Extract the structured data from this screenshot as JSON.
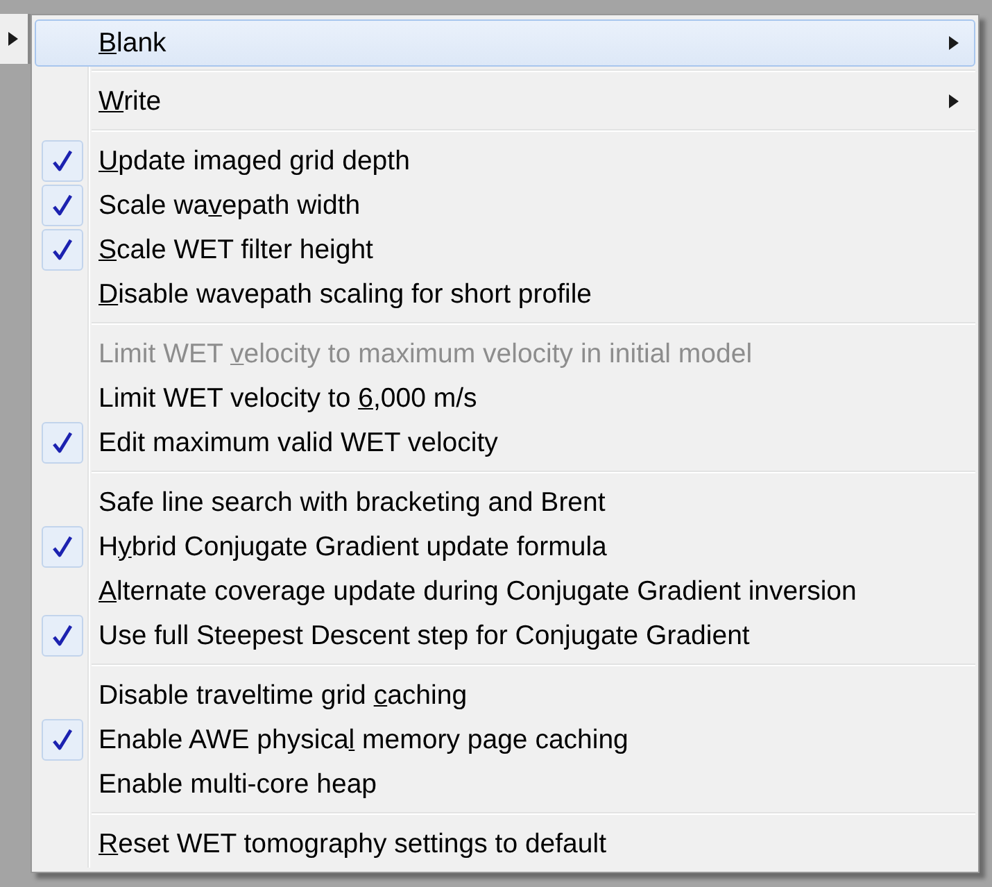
{
  "parent_menu": {
    "items": [
      {
        "submenu": true
      }
    ]
  },
  "menu": {
    "groups": [
      {
        "items": [
          {
            "access_key": "B",
            "text_after": "lank",
            "checked": false,
            "disabled": false,
            "selected": true,
            "submenu": true
          }
        ]
      },
      {
        "items": [
          {
            "access_key": "W",
            "text_after": "rite",
            "checked": false,
            "disabled": false,
            "selected": false,
            "submenu": true
          }
        ]
      },
      {
        "items": [
          {
            "access_key": "U",
            "text_after": "pdate imaged grid depth",
            "checked": true,
            "disabled": false,
            "selected": false,
            "submenu": false
          },
          {
            "text_before": "Scale wa",
            "access_key": "v",
            "text_after": "epath width",
            "checked": true,
            "disabled": false,
            "selected": false,
            "submenu": false
          },
          {
            "access_key": "S",
            "text_after": "cale WET filter height",
            "checked": true,
            "disabled": false,
            "selected": false,
            "submenu": false
          },
          {
            "access_key": "D",
            "text_after": "isable wavepath scaling for short profile",
            "checked": false,
            "disabled": false,
            "selected": false,
            "submenu": false
          }
        ]
      },
      {
        "items": [
          {
            "text_before": "Limit WET ",
            "access_key": "v",
            "text_after": "elocity to maximum velocity in initial model",
            "checked": false,
            "disabled": true,
            "selected": false,
            "submenu": false
          },
          {
            "text_before": "Limit WET velocity to ",
            "access_key": "6",
            "text_after": ",000 m/s",
            "checked": false,
            "disabled": false,
            "selected": false,
            "submenu": false
          },
          {
            "text_before": "Edit maximum valid WET velocity",
            "checked": true,
            "disabled": false,
            "selected": false,
            "submenu": false
          }
        ]
      },
      {
        "items": [
          {
            "text_before": "Safe line search with bracketing and Brent",
            "checked": false,
            "disabled": false,
            "selected": false,
            "submenu": false
          },
          {
            "text_before": "H",
            "access_key": "y",
            "text_after": "brid Conjugate Gradient update formula",
            "checked": true,
            "disabled": false,
            "selected": false,
            "submenu": false
          },
          {
            "access_key": "A",
            "text_after": "lternate coverage update during Conjugate Gradient inversion",
            "checked": false,
            "disabled": false,
            "selected": false,
            "submenu": false
          },
          {
            "text_before": "Use full Steepest Descent step for Conjugate Gradient",
            "checked": true,
            "disabled": false,
            "selected": false,
            "submenu": false
          }
        ]
      },
      {
        "items": [
          {
            "text_before": "Disable traveltime grid ",
            "access_key": "c",
            "text_after": "aching",
            "checked": false,
            "disabled": false,
            "selected": false,
            "submenu": false
          },
          {
            "text_before": "Enable AWE physica",
            "access_key": "l",
            "text_after": " memory page caching",
            "checked": true,
            "disabled": false,
            "selected": false,
            "submenu": false
          },
          {
            "text_before": "Enable multi-core heap",
            "checked": false,
            "disabled": false,
            "selected": false,
            "submenu": false
          }
        ]
      },
      {
        "items": [
          {
            "access_key": "R",
            "text_after": "eset WET tomography settings to default",
            "checked": false,
            "disabled": false,
            "selected": false,
            "submenu": false
          }
        ]
      }
    ]
  }
}
